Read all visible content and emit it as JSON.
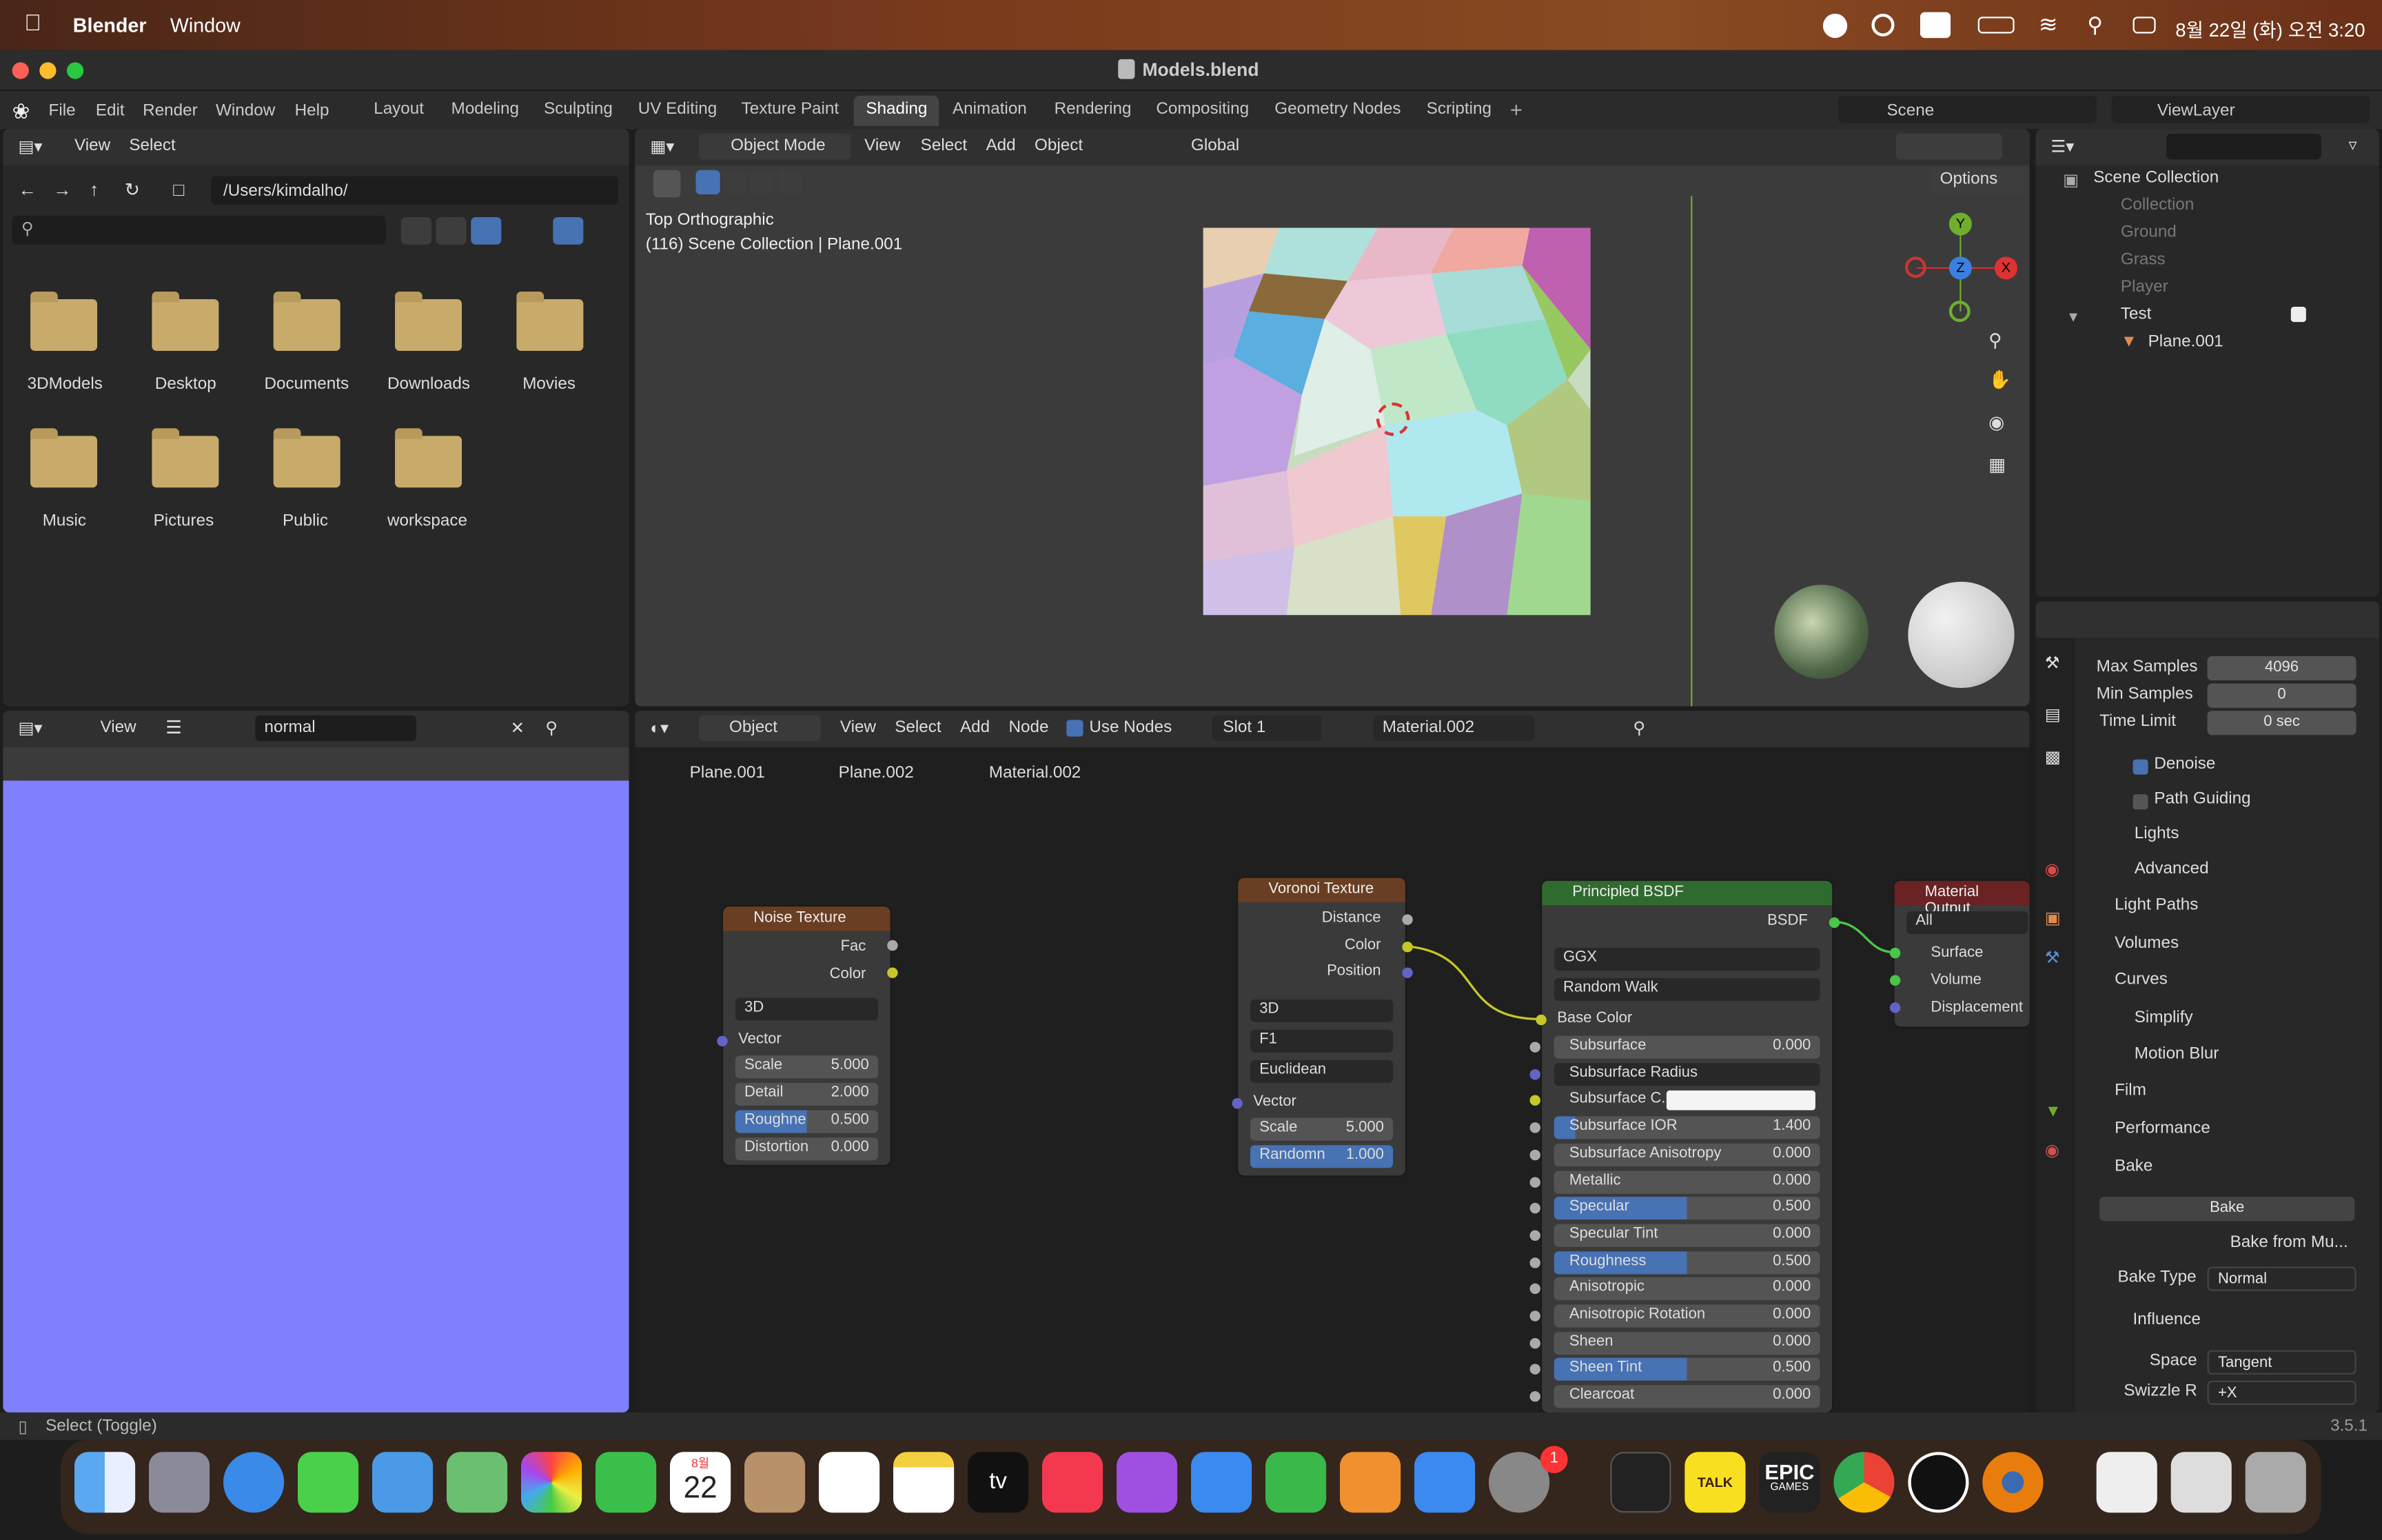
{
  "menubar": {
    "app": "Blender",
    "window": "Window",
    "clock": "8월 22일 (화) 오전 3:20"
  },
  "title": "Models.blend",
  "topbar": {
    "menus": [
      "File",
      "Edit",
      "Render",
      "Window",
      "Help"
    ],
    "tabs": [
      "Layout",
      "Modeling",
      "Sculpting",
      "UV Editing",
      "Texture Paint",
      "Shading",
      "Animation",
      "Rendering",
      "Compositing",
      "Geometry Nodes",
      "Scripting"
    ],
    "active_tab": "Shading",
    "scene": "Scene",
    "view_layer": "ViewLayer"
  },
  "file_browser": {
    "menus": [
      "View",
      "Select"
    ],
    "path": "/Users/kimdalho/",
    "folders": [
      "3DModels",
      "Desktop",
      "Documents",
      "Downloads",
      "Movies",
      "Music",
      "Pictures",
      "Public",
      "workspace"
    ]
  },
  "viewport": {
    "mode": "Object Mode",
    "menus": [
      "View",
      "Select",
      "Add",
      "Object"
    ],
    "transform": "Global",
    "options": "Options",
    "overlay_line1": "Top Orthographic",
    "overlay_line2": "(116) Scene Collection | Plane.001",
    "gizmo": {
      "y": "Y",
      "x": "X",
      "z": "Z"
    }
  },
  "outliner": {
    "root": "Scene Collection",
    "items": [
      {
        "name": "Collection",
        "dim": true
      },
      {
        "name": "Ground",
        "dim": true
      },
      {
        "name": "Grass",
        "dim": true
      },
      {
        "name": "Player",
        "dim": true
      },
      {
        "name": "Test",
        "dim": false
      }
    ],
    "child": "Plane.001"
  },
  "image_editor": {
    "view": "View",
    "image": "normal",
    "color": "#8080ff"
  },
  "node_editor": {
    "object": "Object",
    "menus": [
      "View",
      "Select",
      "Add",
      "Node"
    ],
    "use_nodes": "Use Nodes",
    "slot": "Slot 1",
    "material": "Material.002",
    "breadcrumb": [
      "Plane.001",
      "Plane.002",
      "Material.002"
    ],
    "noise": {
      "title": "Noise Texture",
      "outputs": [
        "Fac",
        "Color"
      ],
      "dim": "3D",
      "input": "Vector",
      "fields": [
        {
          "label": "Scale",
          "value": "5.000"
        },
        {
          "label": "Detail",
          "value": "2.000"
        },
        {
          "label": "Roughne",
          "value": "0.500"
        },
        {
          "label": "Distortion",
          "value": "0.000"
        }
      ]
    },
    "voronoi": {
      "title": "Voronoi Texture",
      "outputs": [
        "Distance",
        "Color",
        "Position"
      ],
      "dims": [
        "3D",
        "F1",
        "Euclidean"
      ],
      "input": "Vector",
      "fields": [
        {
          "label": "Scale",
          "value": "5.000"
        },
        {
          "label": "Randomn",
          "value": "1.000"
        }
      ]
    },
    "bsdf": {
      "title": "Principled BSDF",
      "output": "BSDF",
      "dist": "GGX",
      "sss": "Random Walk",
      "base": "Base Color",
      "fields": [
        {
          "label": "Subsurface",
          "value": "0.000",
          "fill": 0
        },
        {
          "label": "Subsurface Radius",
          "value": "",
          "fill": 0
        },
        {
          "label": "Subsurface C...",
          "value": "",
          "fill": 0
        },
        {
          "label": "Subsurface IOR",
          "value": "1.400",
          "fill": 0.08
        },
        {
          "label": "Subsurface Anisotropy",
          "value": "0.000",
          "fill": 0
        },
        {
          "label": "Metallic",
          "value": "0.000",
          "fill": 0
        },
        {
          "label": "Specular",
          "value": "0.500",
          "fill": 0.5
        },
        {
          "label": "Specular Tint",
          "value": "0.000",
          "fill": 0
        },
        {
          "label": "Roughness",
          "value": "0.500",
          "fill": 0.5
        },
        {
          "label": "Anisotropic",
          "value": "0.000",
          "fill": 0
        },
        {
          "label": "Anisotropic Rotation",
          "value": "0.000",
          "fill": 0
        },
        {
          "label": "Sheen",
          "value": "0.000",
          "fill": 0
        },
        {
          "label": "Sheen Tint",
          "value": "0.500",
          "fill": 0.5
        },
        {
          "label": "Clearcoat",
          "value": "0.000",
          "fill": 0
        }
      ]
    },
    "output": {
      "title": "Material Output",
      "target": "All",
      "inputs": [
        "Surface",
        "Volume",
        "Displacement"
      ]
    }
  },
  "properties": {
    "fields": [
      {
        "label": "Max Samples",
        "value": "4096"
      },
      {
        "label": "Min Samples",
        "value": "0"
      },
      {
        "label": "Time Limit",
        "value": "0 sec"
      }
    ],
    "sub": [
      {
        "label": "Denoise",
        "checked": true
      },
      {
        "label": "Path Guiding",
        "checked": false
      },
      {
        "label": "Lights"
      },
      {
        "label": "Advanced"
      }
    ],
    "sections": [
      "Light Paths",
      "Volumes",
      "Curves",
      "Simplify",
      "Motion Blur",
      "Film",
      "Performance",
      "Bake"
    ],
    "bake": {
      "button": "Bake",
      "from_multires": "Bake from Mu...",
      "bake_type_label": "Bake Type",
      "bake_type": "Normal",
      "influence": "Influence",
      "space_label": "Space",
      "space": "Tangent",
      "swizzle_label": "Swizzle R",
      "swizzle": "+X"
    }
  },
  "statusbar": {
    "hint": "Select (Toggle)",
    "version": "3.5.1"
  },
  "dock": {
    "calendar_month": "8월",
    "calendar_day": "22",
    "badge": "1",
    "tv": "tv",
    "talk": "TALK",
    "epic": "EPIC",
    "games": "GAMES"
  }
}
